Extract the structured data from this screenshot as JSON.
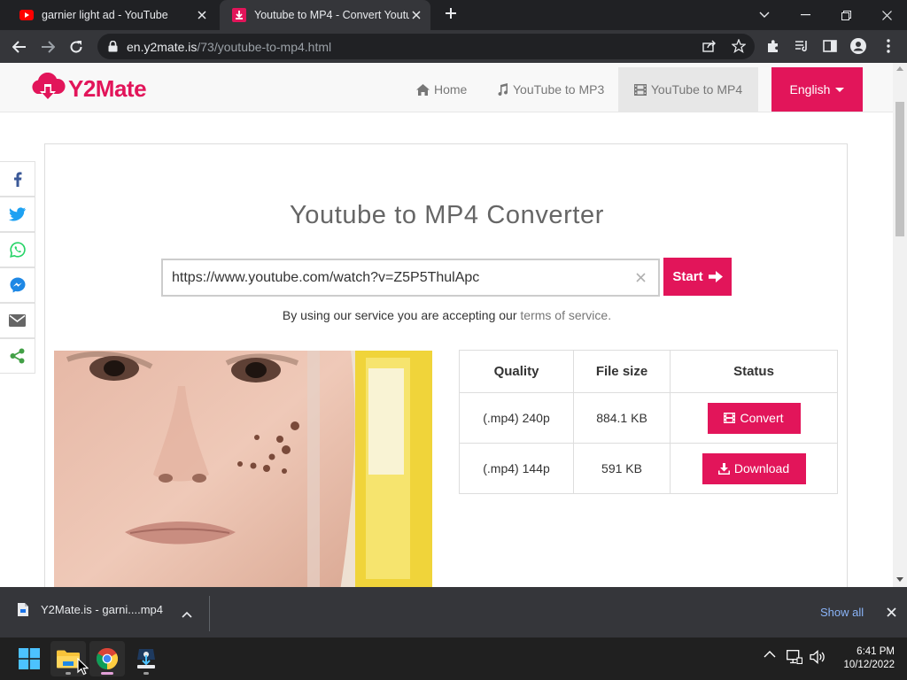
{
  "browser": {
    "tabs": [
      {
        "title": "garnier light ad - YouTube",
        "active": false,
        "favicon": "youtube-favicon"
      },
      {
        "title": "Youtube to MP4 - Convert Youtu",
        "active": true,
        "favicon": "y2mate-favicon"
      }
    ],
    "url_host": "en.y2mate.is",
    "url_path": "/73/youtube-to-mp4.html"
  },
  "site": {
    "logo_text": "Y2Mate",
    "nav": {
      "home": "Home",
      "mp3": "YouTube to MP3",
      "mp4": "YouTube to MP4",
      "language": "English"
    },
    "share_icons": [
      "facebook-icon",
      "twitter-icon",
      "whatsapp-icon",
      "messenger-icon",
      "email-icon",
      "share-icon"
    ],
    "heading": "Youtube to MP4 Converter",
    "input_value": "https://www.youtube.com/watch?v=Z5P5ThulApc",
    "start_label": "Start",
    "terms_prefix": "By using our service you are accepting our",
    "terms_link": "terms of service.",
    "table": {
      "headers": [
        "Quality",
        "File size",
        "Status"
      ],
      "rows": [
        {
          "quality": "(.mp4) 240p",
          "size": "884.1 KB",
          "action": "Convert"
        },
        {
          "quality": "(.mp4) 144p",
          "size": "591 KB",
          "action": "Download"
        }
      ]
    },
    "accent_color": "#e2155a"
  },
  "downloads": {
    "file_name": "Y2Mate.is - garni....mp4",
    "show_all": "Show all"
  },
  "taskbar": {
    "time": "6:41 PM",
    "date": "10/12/2022"
  }
}
